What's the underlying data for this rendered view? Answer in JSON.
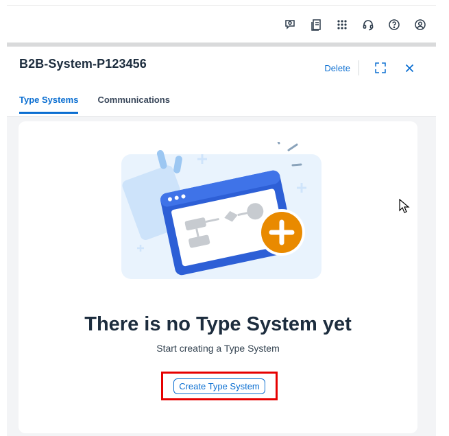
{
  "shell": {
    "icons": [
      "feedback-icon",
      "notes-icon",
      "apps-grid-icon",
      "support-icon",
      "help-icon",
      "user-icon"
    ]
  },
  "header": {
    "title": "B2B-System-P123456",
    "delete_label": "Delete",
    "icons": [
      "fullscreen-icon",
      "close-icon"
    ]
  },
  "tabs": [
    {
      "label": "Type Systems",
      "active": true
    },
    {
      "label": "Communications",
      "active": false
    }
  ],
  "empty_state": {
    "title": "There is no Type System yet",
    "subtitle": "Start creating a Type System",
    "button_label": "Create Type System"
  },
  "colors": {
    "accent": "#0a6ed1",
    "highlight_border": "#e60000",
    "plus_badge": "#e98a00",
    "window_blue": "#2d5fd6"
  }
}
